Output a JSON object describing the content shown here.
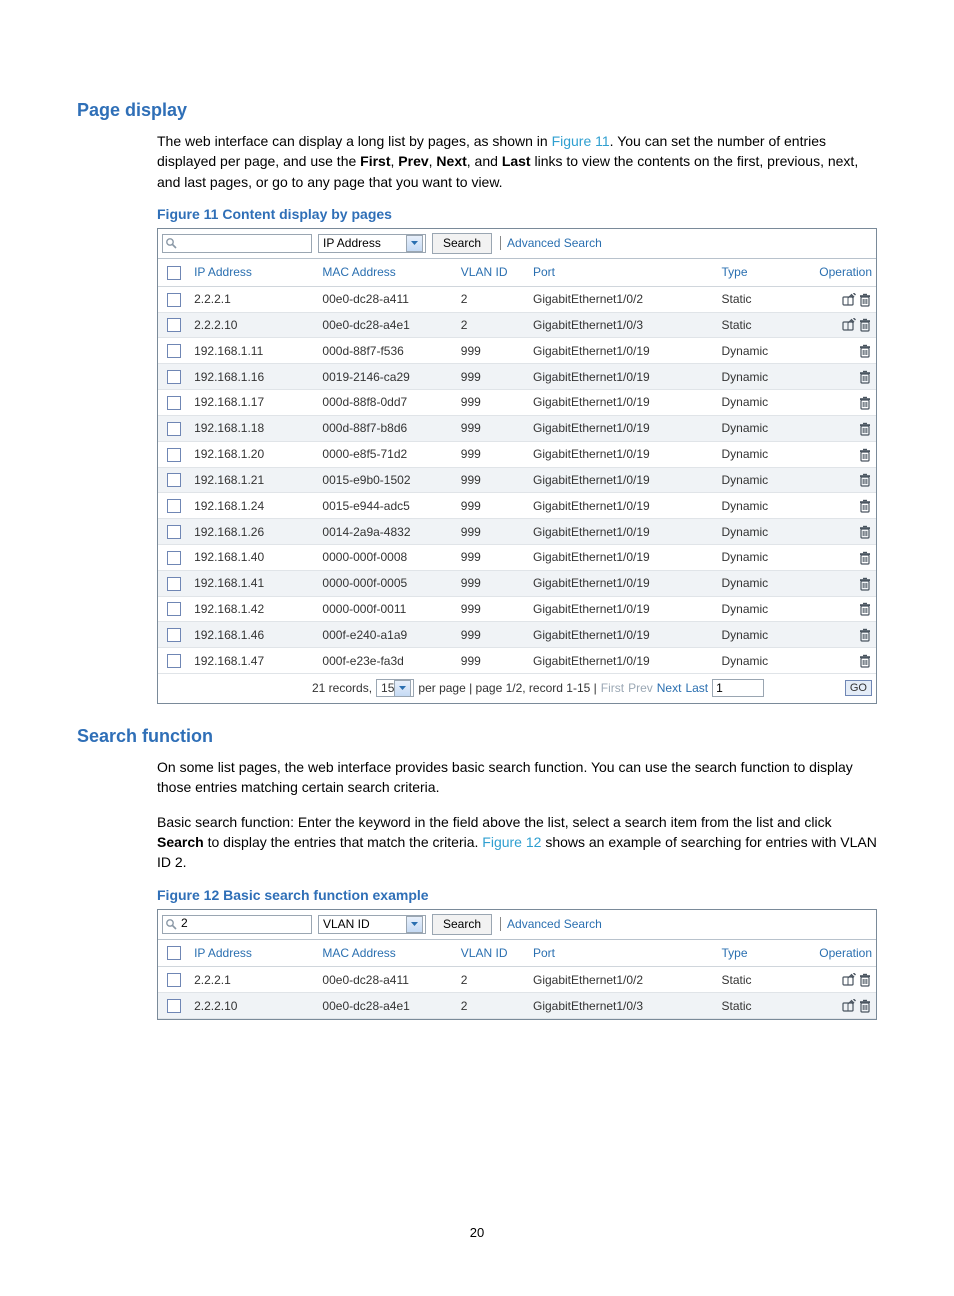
{
  "sections": {
    "page_display": {
      "heading": "Page display",
      "para1_pre": "The web interface can display a long list by pages, as shown in ",
      "para1_link": "Figure 11",
      "para1_post": ". You can set the number of entries displayed per page, and use the ",
      "bold_first": "First",
      "sep1": ", ",
      "bold_prev": "Prev",
      "sep2": ", ",
      "bold_next": "Next",
      "sep3": ", and ",
      "bold_last": "Last",
      "para1_tail": " links to view the contents on the first, previous, next, and last pages, or go to any page that you want to view.",
      "fig_caption": "Figure 11 Content display by pages"
    },
    "search_function": {
      "heading": "Search function",
      "para1": "On some list pages, the web interface provides basic search function. You can use the search function to display those entries matching certain search criteria.",
      "para2_pre": "Basic search function: Enter the keyword in the field above the list, select a search item from the list and click ",
      "bold_search": "Search",
      "para2_mid": " to display the entries that match the criteria. ",
      "para2_link": "Figure 12",
      "para2_post": " shows an example of searching for entries with VLAN ID 2.",
      "fig_caption": "Figure 12 Basic search function example"
    }
  },
  "fig11": {
    "search_value": "",
    "search_field": "IP Address",
    "search_btn": "Search",
    "advanced": "Advanced Search",
    "headers": [
      "IP Address",
      "MAC Address",
      "VLAN ID",
      "Port",
      "Type",
      "Operation"
    ],
    "rows": [
      {
        "ip": "2.2.2.1",
        "mac": "00e0-dc28-a411",
        "vlan": "2",
        "port": "GigabitEthernet1/0/2",
        "type": "Static",
        "edit": true
      },
      {
        "ip": "2.2.2.10",
        "mac": "00e0-dc28-a4e1",
        "vlan": "2",
        "port": "GigabitEthernet1/0/3",
        "type": "Static",
        "edit": true
      },
      {
        "ip": "192.168.1.11",
        "mac": "000d-88f7-f536",
        "vlan": "999",
        "port": "GigabitEthernet1/0/19",
        "type": "Dynamic",
        "edit": false
      },
      {
        "ip": "192.168.1.16",
        "mac": "0019-2146-ca29",
        "vlan": "999",
        "port": "GigabitEthernet1/0/19",
        "type": "Dynamic",
        "edit": false
      },
      {
        "ip": "192.168.1.17",
        "mac": "000d-88f8-0dd7",
        "vlan": "999",
        "port": "GigabitEthernet1/0/19",
        "type": "Dynamic",
        "edit": false
      },
      {
        "ip": "192.168.1.18",
        "mac": "000d-88f7-b8d6",
        "vlan": "999",
        "port": "GigabitEthernet1/0/19",
        "type": "Dynamic",
        "edit": false
      },
      {
        "ip": "192.168.1.20",
        "mac": "0000-e8f5-71d2",
        "vlan": "999",
        "port": "GigabitEthernet1/0/19",
        "type": "Dynamic",
        "edit": false
      },
      {
        "ip": "192.168.1.21",
        "mac": "0015-e9b0-1502",
        "vlan": "999",
        "port": "GigabitEthernet1/0/19",
        "type": "Dynamic",
        "edit": false
      },
      {
        "ip": "192.168.1.24",
        "mac": "0015-e944-adc5",
        "vlan": "999",
        "port": "GigabitEthernet1/0/19",
        "type": "Dynamic",
        "edit": false
      },
      {
        "ip": "192.168.1.26",
        "mac": "0014-2a9a-4832",
        "vlan": "999",
        "port": "GigabitEthernet1/0/19",
        "type": "Dynamic",
        "edit": false
      },
      {
        "ip": "192.168.1.40",
        "mac": "0000-000f-0008",
        "vlan": "999",
        "port": "GigabitEthernet1/0/19",
        "type": "Dynamic",
        "edit": false
      },
      {
        "ip": "192.168.1.41",
        "mac": "0000-000f-0005",
        "vlan": "999",
        "port": "GigabitEthernet1/0/19",
        "type": "Dynamic",
        "edit": false
      },
      {
        "ip": "192.168.1.42",
        "mac": "0000-000f-0011",
        "vlan": "999",
        "port": "GigabitEthernet1/0/19",
        "type": "Dynamic",
        "edit": false
      },
      {
        "ip": "192.168.1.46",
        "mac": "000f-e240-a1a9",
        "vlan": "999",
        "port": "GigabitEthernet1/0/19",
        "type": "Dynamic",
        "edit": false
      },
      {
        "ip": "192.168.1.47",
        "mac": "000f-e23e-fa3d",
        "vlan": "999",
        "port": "GigabitEthernet1/0/19",
        "type": "Dynamic",
        "edit": false
      }
    ],
    "pager": {
      "records_pre": "21 records,",
      "per_page_value": "15",
      "per_page_label": "per page | page 1/2, record 1-15 |",
      "first": "First",
      "prev": "Prev",
      "next": "Next",
      "last": "Last",
      "page_input": "1",
      "go": "GO"
    }
  },
  "fig12": {
    "search_value": "2",
    "search_field": "VLAN ID",
    "search_btn": "Search",
    "advanced": "Advanced Search",
    "headers": [
      "IP Address",
      "MAC Address",
      "VLAN ID",
      "Port",
      "Type",
      "Operation"
    ],
    "rows": [
      {
        "ip": "2.2.2.1",
        "mac": "00e0-dc28-a411",
        "vlan": "2",
        "port": "GigabitEthernet1/0/2",
        "type": "Static",
        "edit": true
      },
      {
        "ip": "2.2.2.10",
        "mac": "00e0-dc28-a4e1",
        "vlan": "2",
        "port": "GigabitEthernet1/0/3",
        "type": "Static",
        "edit": true
      }
    ]
  },
  "page_number": "20"
}
